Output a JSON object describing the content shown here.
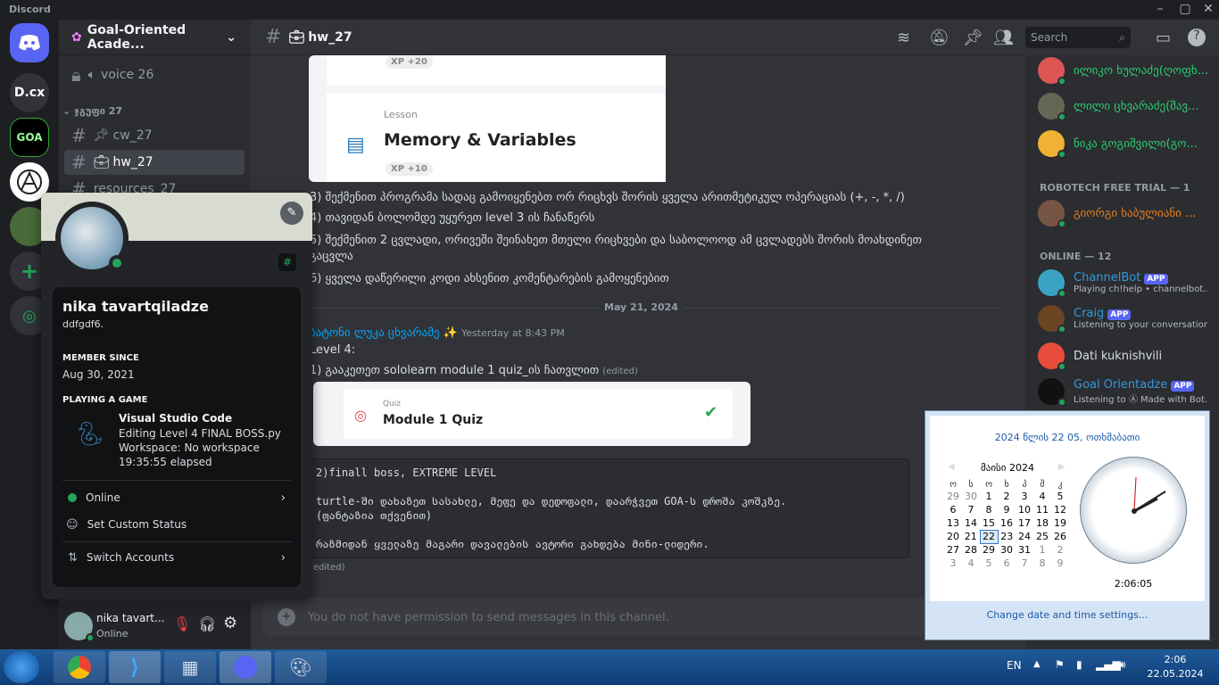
{
  "window": {
    "app_title": "Discord"
  },
  "guilds": [
    {
      "label": "D.cx"
    },
    {
      "label": "GOA"
    }
  ],
  "server": {
    "name": "Goal-Oriented Acade..."
  },
  "channels": {
    "voice": "voice 26",
    "category": "ჯგუფი 27",
    "items": [
      {
        "label": "cw_27"
      },
      {
        "label": "hw_27"
      },
      {
        "label": "resources_27"
      }
    ]
  },
  "user": {
    "name": "nika tavart...",
    "status": "Online"
  },
  "chat": {
    "channel": "hw_27",
    "search_placeholder": "Search",
    "card1_xp": "XP +20",
    "card2": {
      "type": "Lesson",
      "title": "Memory & Variables",
      "xp": "XP +10"
    },
    "lines": [
      "3) შექმენით პროგრამა სადაც გამოიყენებთ ორ რიცხვს შორის ყველა არითმეტიკულ ოპერაციას (+, -, *, /)",
      "4) თავიდან ბოლომდე უყურეთ level 3 ის ჩანაწერს",
      "5)  შექმენით 2 ცვლადი, ორივეში შეინახეთ მთელი რიცხვები და საბოლოოდ ამ ცვლადებს შორის მოახდინეთ",
      "გაცვლა",
      "6) ყველა დაწერილი კოდი ახსენით კომენტარების გამოყენებით"
    ],
    "date_divider": "May 21, 2024",
    "msg2": {
      "author": "ბატონი ლუკა ცხვარამე",
      "time": "Yesterday at 8:43 PM",
      "l1": "Level 4:",
      "l2": "1) გააკეთეთ sololearn module 1 quiz_ის ჩათვლით",
      "edited": "(edited)"
    },
    "quiz": {
      "type": "Quiz",
      "title": "Module 1 Quiz"
    },
    "code": [
      "2)finall boss, EXTREME LEVEL",
      "",
      "turtle-ში დახაზეთ სასახლე, მეფე და დედოფალი, დაარჭვეთ GOA-ს დროშა კოშკზე.",
      "(ფანტაზია თქვენით)",
      "",
      "რაზმიდან ყველაზე მაგარი დავალების ავტორი გახდება მინი-ლიდერი."
    ],
    "edited2": "(edited)",
    "composer": "You do not have permission to send messages in this channel."
  },
  "members": {
    "top": [
      {
        "name": "ილიკო ხულაძე(ღოფხ..."
      },
      {
        "name": "ლილი ცხვარაძე(შავ..."
      },
      {
        "name": "ნიკა გოგიშვილი(გო..."
      }
    ],
    "section1": "ROBOTECH FREE TRIAL — 1",
    "trial": [
      {
        "name": "გიორგი ხაბულიანი ..."
      }
    ],
    "section2": "ONLINE — 12",
    "online": [
      {
        "name": "ChannelBot",
        "badge": "APP",
        "status": "Playing ch!help • channelbot..."
      },
      {
        "name": "Craig",
        "badge": "APP",
        "status": "Listening to your conversations"
      },
      {
        "name": "Dati kuknishvili",
        "badge": "",
        "status": ""
      },
      {
        "name": "Goal Orientadze",
        "badge": "APP",
        "status": "Listening to Ⓐ Made with Bot..."
      }
    ]
  },
  "profile": {
    "name": "nika tavartqiladze",
    "handle": "ddfgdf6.",
    "member_since_label": "MEMBER SINCE",
    "member_since": "Aug 30, 2021",
    "playing_label": "PLAYING A GAME",
    "game": "Visual Studio Code",
    "game_l1": "Editing Level 4 FINAL BOSS.py",
    "game_l2": "Workspace: No workspace",
    "game_l3": "19:35:55 elapsed",
    "online": "Online",
    "custom": "Set Custom Status",
    "switch": "Switch Accounts"
  },
  "clock": {
    "date_header": "2024 წლის 22 05, ოთხშაბათი",
    "month": "მაისი 2024",
    "weekdays": [
      "ო",
      "ს",
      "ო",
      "ხ",
      "პ",
      "შ",
      "კ"
    ],
    "weeks": [
      [
        "29",
        "30",
        "1",
        "2",
        "3",
        "4",
        "5"
      ],
      [
        "6",
        "7",
        "8",
        "9",
        "10",
        "11",
        "12"
      ],
      [
        "13",
        "14",
        "15",
        "16",
        "17",
        "18",
        "19"
      ],
      [
        "20",
        "21",
        "22",
        "23",
        "24",
        "25",
        "26"
      ],
      [
        "27",
        "28",
        "29",
        "30",
        "31",
        "1",
        "2"
      ],
      [
        "3",
        "4",
        "5",
        "6",
        "7",
        "8",
        "9"
      ]
    ],
    "today": "22",
    "time": "2:06:05",
    "link": "Change date and time settings..."
  },
  "taskbar": {
    "lang": "EN",
    "time": "2:06",
    "date": "22.05.2024"
  },
  "colors": {
    "accent": "#5865f2",
    "online": "#23a55a",
    "link": "#00a8fc"
  }
}
